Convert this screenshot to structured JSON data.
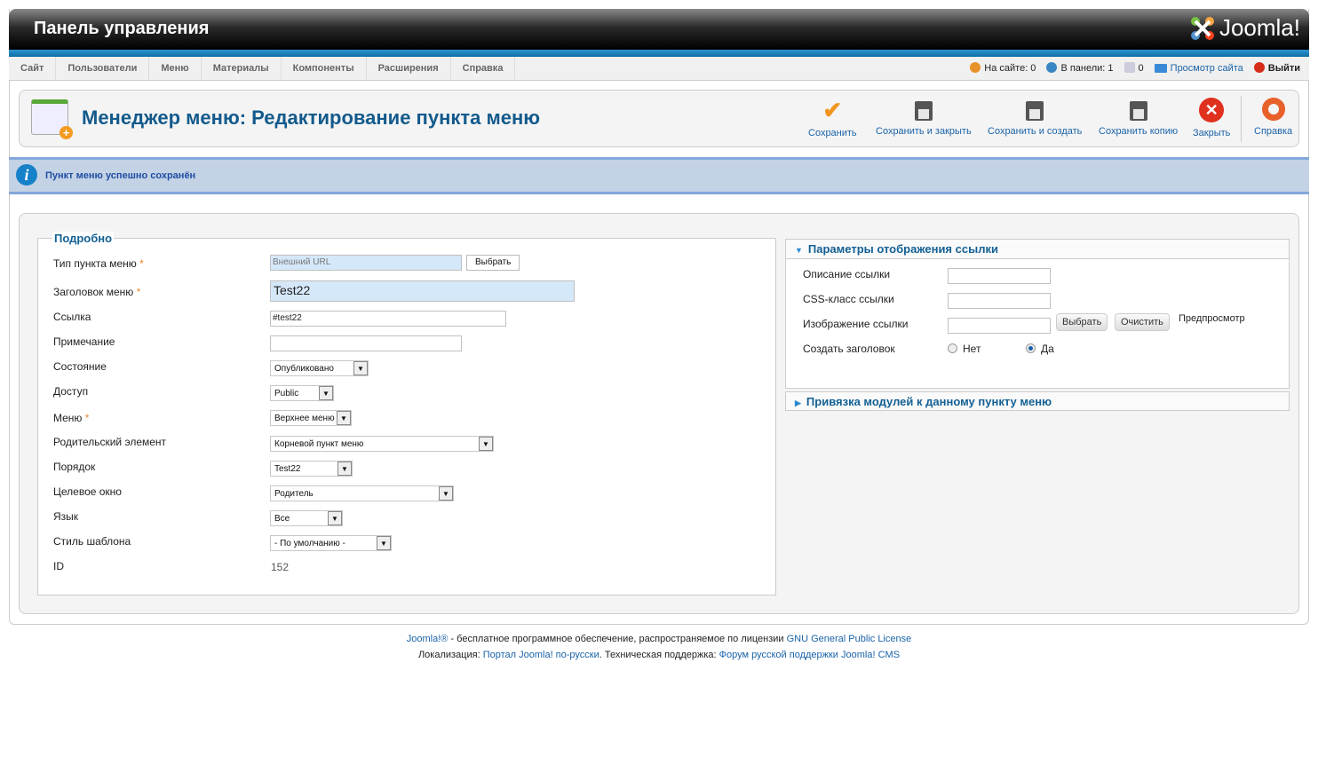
{
  "header": {
    "title": "Панель управления",
    "logo": "Joomla!"
  },
  "menu": [
    "Сайт",
    "Пользователи",
    "Меню",
    "Материалы",
    "Компоненты",
    "Расширения",
    "Справка"
  ],
  "status": {
    "on_site": "На сайте: 0",
    "in_panel": "В панели: 1",
    "messages": "0",
    "view_site": "Просмотр сайта",
    "logout": "Выйти"
  },
  "toolbar": {
    "title": "Менеджер меню: Редактирование пункта меню",
    "save": "Сохранить",
    "save_close": "Сохранить и закрыть",
    "save_new": "Сохранить и создать",
    "save_copy": "Сохранить копию",
    "close": "Закрыть",
    "help": "Справка"
  },
  "message": "Пункт меню успешно сохранён",
  "details": {
    "legend": "Подробно",
    "type_label": "Тип пункта меню",
    "type_value": "Внешний URL",
    "select_btn": "Выбрать",
    "title_label": "Заголовок меню",
    "title_value": "Test22",
    "link_label": "Ссылка",
    "link_value": "#test22",
    "note_label": "Примечание",
    "note_value": "",
    "state_label": "Состояние",
    "state_value": "Опубликовано",
    "access_label": "Доступ",
    "access_value": "Public",
    "menu_label": "Меню",
    "menu_value": "Верхнее меню",
    "parent_label": "Родительский элемент",
    "parent_value": "Корневой пункт меню",
    "order_label": "Порядок",
    "order_value": "Test22",
    "target_label": "Целевое окно",
    "target_value": "Родитель",
    "lang_label": "Язык",
    "lang_value": "Все",
    "style_label": "Стиль шаблона",
    "style_value": "- По умолчанию -",
    "id_label": "ID",
    "id_value": "152",
    "required": "*"
  },
  "link_params": {
    "title": "Параметры отображения ссылки",
    "desc_label": "Описание ссылки",
    "css_label": "CSS-класс ссылки",
    "image_label": "Изображение ссылки",
    "select_btn": "Выбрать",
    "clear_btn": "Очистить",
    "preview": "Предпросмотр",
    "heading_label": "Создать заголовок",
    "no": "Нет",
    "yes": "Да",
    "heading_selected": "Да"
  },
  "modules_panel": {
    "title": "Привязка модулей к данному пункту меню"
  },
  "footer": {
    "l1_a": "Joomla!®",
    "l1_b": " - бесплатное программное обеспечение, распространяемое по лицензии ",
    "l1_c": "GNU General Public License",
    "l2_a": "Локализация: ",
    "l2_b": "Портал Joomla! по-русски",
    "l2_c": ". Техническая поддержка: ",
    "l2_d": "Форум русской поддержки Joomla! CMS"
  }
}
